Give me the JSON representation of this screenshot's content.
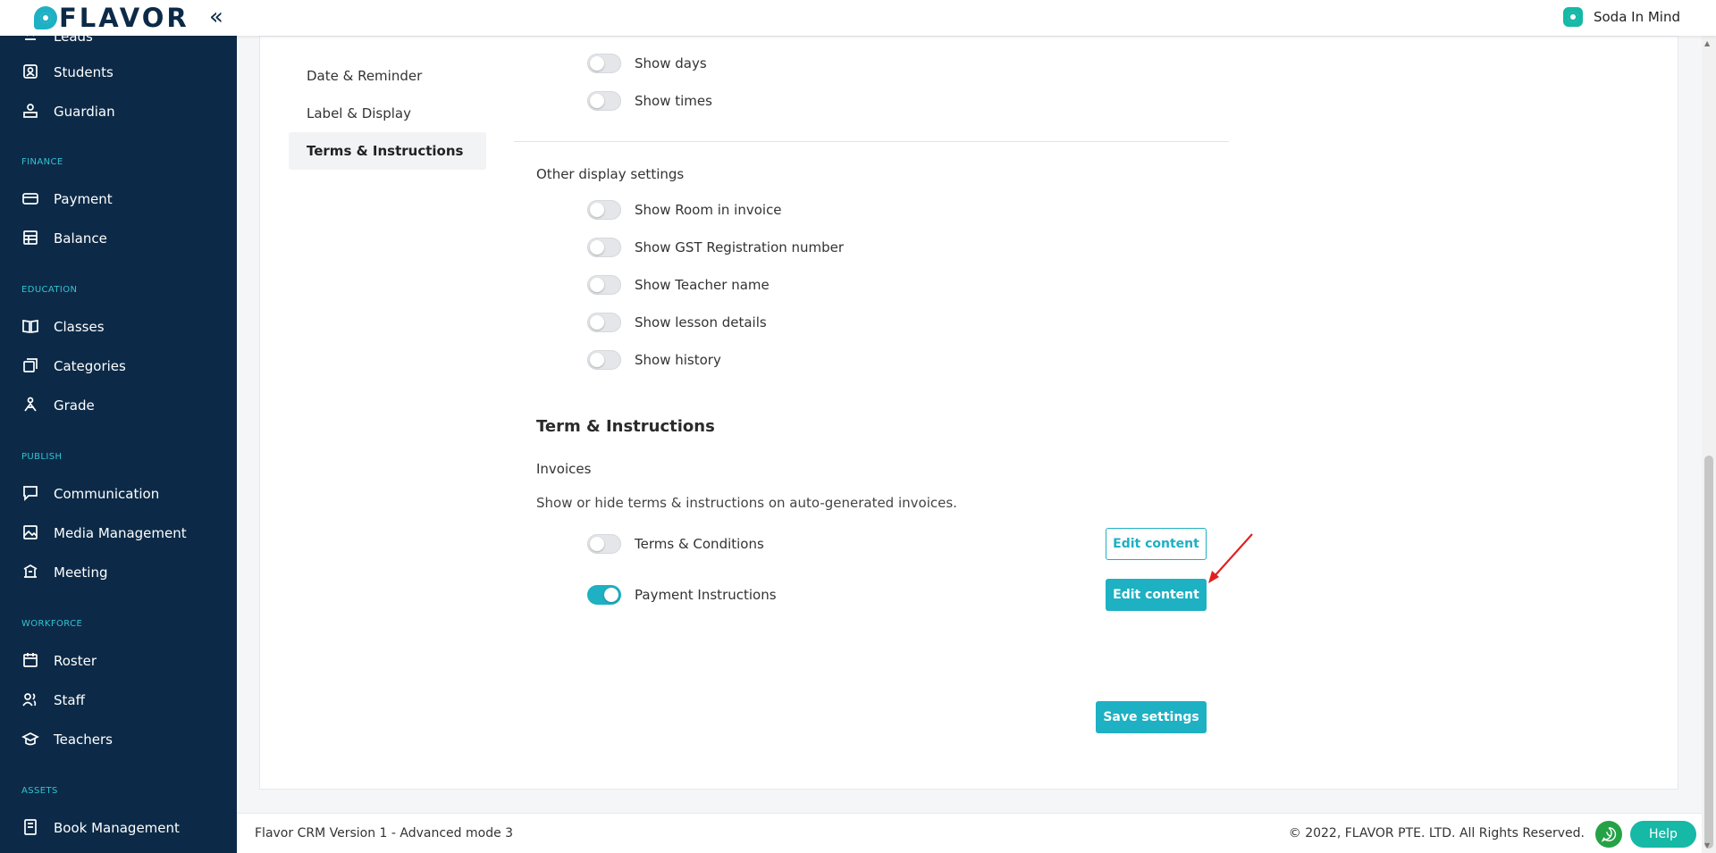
{
  "header": {
    "logo_text": "FLAVOR",
    "org_name": "Soda In Mind"
  },
  "sidebar": {
    "partial_item": "Leads",
    "items_top": [
      {
        "label": "Students",
        "icon": "student-icon"
      },
      {
        "label": "Guardian",
        "icon": "guardian-icon"
      }
    ],
    "sections": [
      {
        "title": "FINANCE",
        "items": [
          {
            "label": "Payment",
            "icon": "payment-icon"
          },
          {
            "label": "Balance",
            "icon": "balance-icon"
          }
        ]
      },
      {
        "title": "EDUCATION",
        "items": [
          {
            "label": "Classes",
            "icon": "book-icon"
          },
          {
            "label": "Categories",
            "icon": "categories-icon"
          },
          {
            "label": "Grade",
            "icon": "grade-icon"
          }
        ]
      },
      {
        "title": "PUBLISH",
        "items": [
          {
            "label": "Communication",
            "icon": "chat-icon"
          },
          {
            "label": "Media Management",
            "icon": "media-icon"
          },
          {
            "label": "Meeting",
            "icon": "meeting-icon"
          }
        ]
      },
      {
        "title": "WORKFORCE",
        "items": [
          {
            "label": "Roster",
            "icon": "calendar-icon"
          },
          {
            "label": "Staff",
            "icon": "staff-icon"
          },
          {
            "label": "Teachers",
            "icon": "teacher-icon"
          }
        ]
      },
      {
        "title": "ASSETS",
        "items": [
          {
            "label": "Book Management",
            "icon": "book-management-icon"
          }
        ]
      }
    ]
  },
  "submenu": {
    "items": [
      "Date & Reminder",
      "Label & Display",
      "Terms & Instructions"
    ],
    "active": "Terms & Instructions"
  },
  "date_display": {
    "toggles": [
      {
        "label": "Show days",
        "on": false
      },
      {
        "label": "Show times",
        "on": false
      }
    ]
  },
  "other_display": {
    "title": "Other display settings",
    "toggles": [
      {
        "label": "Show Room in invoice",
        "on": false
      },
      {
        "label": "Show GST Registration number",
        "on": false
      },
      {
        "label": "Show Teacher name",
        "on": false
      },
      {
        "label": "Show lesson details",
        "on": false
      },
      {
        "label": "Show history",
        "on": false
      }
    ]
  },
  "terms": {
    "title": "Term & Instructions",
    "subtitle": "Invoices",
    "description": "Show or hide terms & instructions on auto-generated invoices.",
    "rows": [
      {
        "label": "Terms & Conditions",
        "on": false,
        "button": "Edit content"
      },
      {
        "label": "Payment Instructions",
        "on": true,
        "button": "Edit content"
      }
    ]
  },
  "save_label": "Save settings",
  "footer": {
    "version": "Flavor CRM Version 1 - Advanced mode 3",
    "copyright": "© 2022, FLAVOR PTE. LTD. All Rights Reserved.",
    "help": "Help"
  },
  "colors": {
    "accent": "#1eb0c3",
    "sidebar_bg": "#0c2a47",
    "section_title": "#33c3d3",
    "annotation_arrow": "#e02020"
  }
}
